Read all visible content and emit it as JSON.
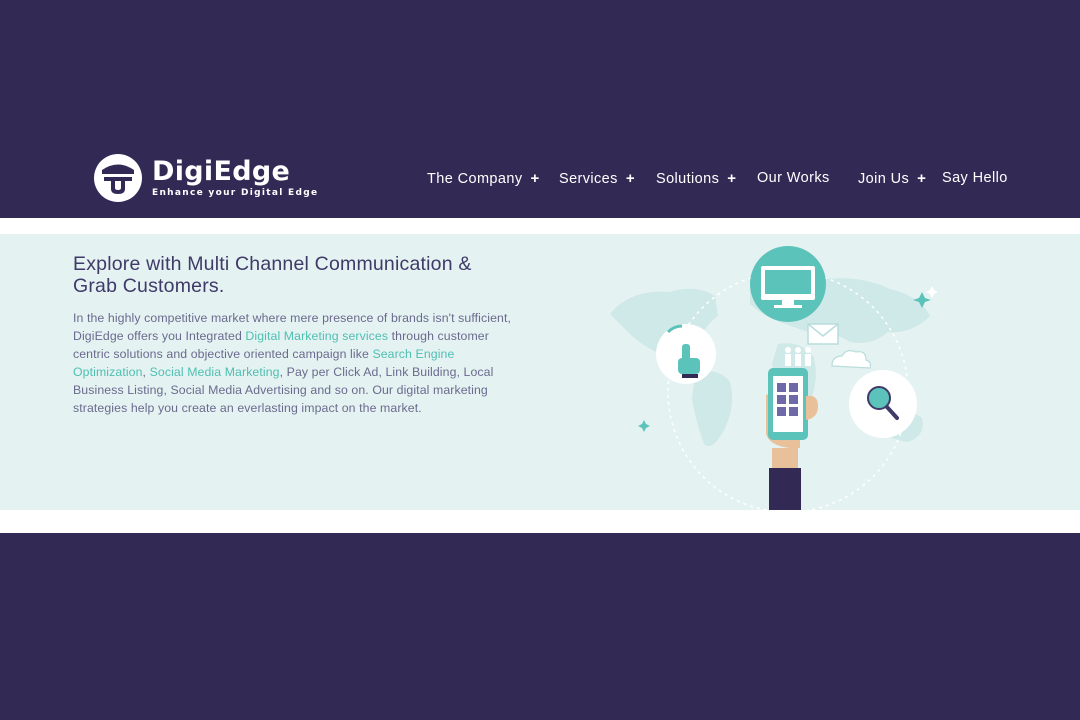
{
  "brand": {
    "name": "DigiEdge",
    "tagline": "Enhance your Digital Edge"
  },
  "nav": {
    "items": [
      {
        "label": "The Company",
        "has_submenu": true
      },
      {
        "label": "Services",
        "has_submenu": true
      },
      {
        "label": "Solutions",
        "has_submenu": true
      },
      {
        "label": "Our Works",
        "has_submenu": false
      },
      {
        "label": "Join Us",
        "has_submenu": true
      },
      {
        "label": "Say Hello",
        "has_submenu": false
      }
    ],
    "submenu_symbol": "+"
  },
  "hero": {
    "title": "Explore with Multi Channel Communication & Grab Customers.",
    "body": {
      "part1": "In the highly competitive market where mere presence of brands isn't sufficient, DigiEdge offers you Integrated ",
      "link1": "Digital Marketing services",
      "part2": " through customer centric solutions and objective oriented campaign like ",
      "link2": "Search Engine Optimization",
      "sep": ", ",
      "link3": "Social Media Marketing",
      "part3": ", Pay per Click Ad, Link Building, Local Business Listing, Social Media Advertising and so on. Our digital marketing strategies help you create an everlasting impact on the market."
    }
  },
  "colors": {
    "page_background": "#322a55",
    "hero_background": "#e4f2f2",
    "accent_teal": "#4fbfb2",
    "title_text": "#3f3a68",
    "body_text": "#6b6a8e"
  },
  "illustration": {
    "icons": [
      "world-map",
      "monitor-icon",
      "touch-hand-icon",
      "email-icon",
      "cloud-icon",
      "people-icon",
      "smartphone-icon",
      "magnifier-icon",
      "sparkle-icon"
    ]
  }
}
